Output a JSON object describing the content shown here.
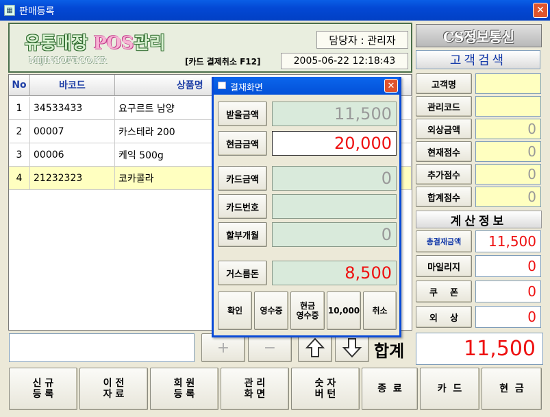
{
  "window": {
    "title": "판매등록",
    "close": "✕"
  },
  "header": {
    "logo_pre": "유통매장 ",
    "logo_pos": "POS",
    "logo_post": "관리",
    "site": "MIJINSOFT.CO.KR",
    "cashier": "담당자 : 관리자",
    "card_cancel": "[카드 결제취소 F12]",
    "datetime": "2005-06-22  12:18:43"
  },
  "table": {
    "columns": [
      "No",
      "바코드",
      "상품명"
    ],
    "rows": [
      {
        "no": "1",
        "barcode": "34533433",
        "name": "요구르트 남양"
      },
      {
        "no": "2",
        "barcode": "00007",
        "name": "카스테라 200"
      },
      {
        "no": "3",
        "barcode": "00006",
        "name": "케익 500g"
      },
      {
        "no": "4",
        "barcode": "21232323",
        "name": "코카콜라"
      }
    ]
  },
  "bottom": {
    "input_value": "",
    "plus": "+",
    "minus": "−",
    "total_label": "합계",
    "total_value": "11,500"
  },
  "function_buttons": [
    {
      "line1": "신 규",
      "line2": "등 록"
    },
    {
      "line1": "이 전",
      "line2": "자 료"
    },
    {
      "line1": "회 원",
      "line2": "등 록"
    },
    {
      "line1": "관 리",
      "line2": "화 면"
    },
    {
      "line1": "숫 자",
      "line2": "버 턴"
    },
    {
      "line1": "종  료",
      "line2": ""
    },
    {
      "line1": "카  드",
      "line2": ""
    },
    {
      "line1": "현  금",
      "line2": ""
    }
  ],
  "cs": {
    "title": "CS정보통신",
    "search": "고객검색",
    "customer_fields": [
      {
        "label": "고객명",
        "value": ""
      },
      {
        "label": "관리코드",
        "value": ""
      },
      {
        "label": "외상금액",
        "value": "0"
      },
      {
        "label": "현재점수",
        "value": "0"
      },
      {
        "label": "추가점수",
        "value": "0"
      },
      {
        "label": "합계점수",
        "value": "0"
      }
    ],
    "calc_title": "계산정보",
    "calc_fields": [
      {
        "label": "총결재금액",
        "value": "11,500"
      },
      {
        "label": "마일리지",
        "value": "0"
      },
      {
        "label": "쿠    폰",
        "value": "0"
      },
      {
        "label": "외    상",
        "value": "0"
      }
    ]
  },
  "dialog": {
    "title": "결재화면",
    "close": "✕",
    "fields": [
      {
        "label": "받을금액",
        "value": "11,500"
      },
      {
        "label": "현금금액",
        "value": "20,000"
      },
      {
        "label": "카드금액",
        "value": "0"
      },
      {
        "label": "카드번호",
        "value": ""
      },
      {
        "label": "할부개월",
        "value": "0"
      },
      {
        "label": "거스름돈",
        "value": "8,500"
      }
    ],
    "buttons": [
      {
        "line1": "확인",
        "line2": ""
      },
      {
        "line1": "영수증",
        "line2": ""
      },
      {
        "line1": "현금",
        "line2": "영수증"
      },
      {
        "line1": "10,000",
        "line2": ""
      },
      {
        "line1": "취소",
        "line2": ""
      }
    ]
  },
  "colors": {
    "titlebar": "#0348d4",
    "total_red": "#ee1111",
    "highlight_row": "#ffffc0",
    "header_text": "#1f3fa6"
  }
}
